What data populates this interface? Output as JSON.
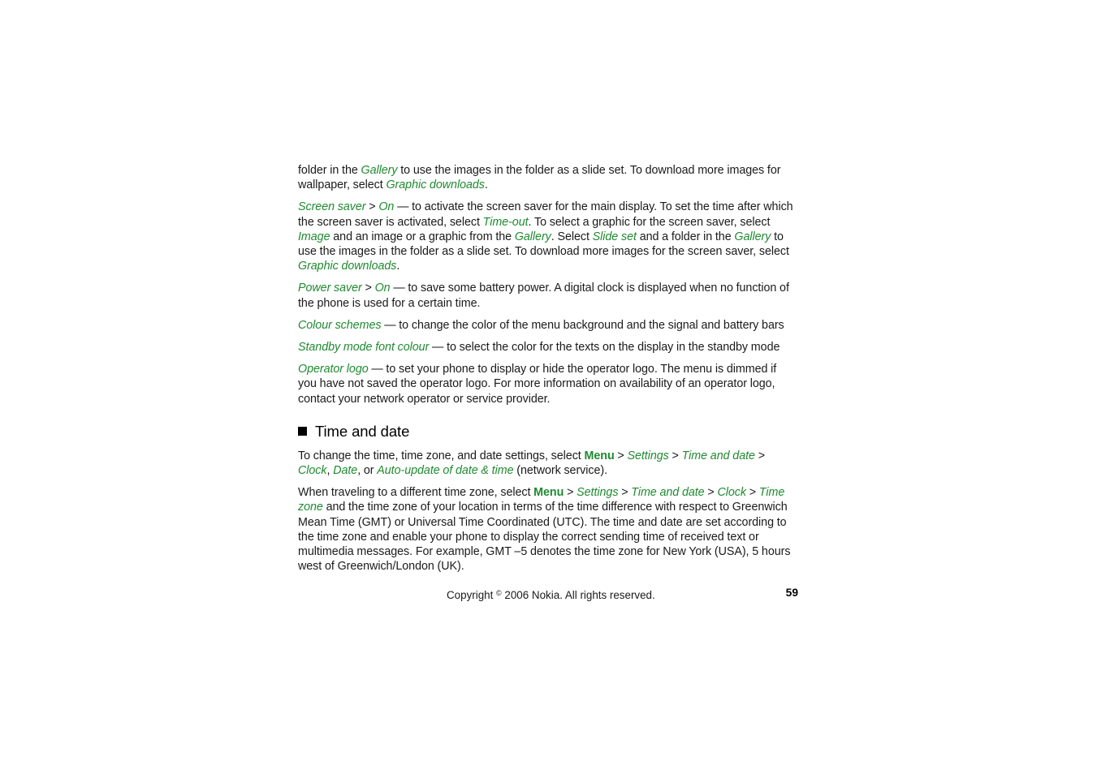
{
  "document": {
    "background_color": "#ffffff",
    "text_color": "#1a1a1a",
    "accent_color": "#1f8a30"
  },
  "body": {
    "paragraphs": [
      {
        "id": "wallpaper-folder",
        "runs": [
          {
            "style": "plain",
            "text": "folder in the "
          },
          {
            "style": "term",
            "text": "Gallery"
          },
          {
            "style": "plain",
            "text": " to use the images in the folder as a slide set. To download more images for wallpaper, select "
          },
          {
            "style": "term",
            "text": "Graphic downloads"
          },
          {
            "style": "plain",
            "text": "."
          }
        ]
      },
      {
        "id": "screen-saver",
        "runs": [
          {
            "style": "term",
            "text": "Screen saver"
          },
          {
            "style": "plain",
            "text": " > "
          },
          {
            "style": "term",
            "text": "On"
          },
          {
            "style": "plain",
            "text": " — to activate the screen saver for the main display. To set the time after which the screen saver is activated, select "
          },
          {
            "style": "term",
            "text": "Time-out"
          },
          {
            "style": "plain",
            "text": ". To select a graphic for the screen saver, select "
          },
          {
            "style": "term",
            "text": "Image"
          },
          {
            "style": "plain",
            "text": " and an image or a graphic from the "
          },
          {
            "style": "term",
            "text": "Gallery"
          },
          {
            "style": "plain",
            "text": ". Select "
          },
          {
            "style": "term",
            "text": "Slide set"
          },
          {
            "style": "plain",
            "text": " and a folder in the "
          },
          {
            "style": "term",
            "text": "Gallery"
          },
          {
            "style": "plain",
            "text": " to use the images in the folder as a slide set. To download more images for the screen saver, select "
          },
          {
            "style": "term",
            "text": "Graphic downloads"
          },
          {
            "style": "plain",
            "text": "."
          }
        ]
      },
      {
        "id": "power-saver",
        "runs": [
          {
            "style": "term",
            "text": "Power saver"
          },
          {
            "style": "plain",
            "text": " > "
          },
          {
            "style": "term",
            "text": "On"
          },
          {
            "style": "plain",
            "text": " — to save some battery power. A digital clock is displayed when no function of the phone is used for a certain time."
          }
        ]
      },
      {
        "id": "colour-schemes",
        "runs": [
          {
            "style": "term",
            "text": "Colour schemes"
          },
          {
            "style": "plain",
            "text": " — to change the color of the menu background and the signal and battery bars"
          }
        ]
      },
      {
        "id": "standby-mode-font-colour",
        "runs": [
          {
            "style": "term",
            "text": "Standby mode font colour"
          },
          {
            "style": "plain",
            "text": " — to select the color for the texts on the display in the standby mode"
          }
        ]
      },
      {
        "id": "operator-logo",
        "runs": [
          {
            "style": "term",
            "text": "Operator logo"
          },
          {
            "style": "plain",
            "text": " — to set your phone to display or hide the operator logo. The menu is dimmed if you have not saved the operator logo. For more information on availability of an operator logo, contact your network operator or service provider."
          }
        ]
      }
    ]
  },
  "section": {
    "heading": "Time and date",
    "bullet": "square-bullet",
    "paragraphs": [
      {
        "id": "change-time-settings",
        "runs": [
          {
            "style": "plain",
            "text": "To change the time, time zone, and date settings, select "
          },
          {
            "style": "term-bold",
            "text": "Menu"
          },
          {
            "style": "plain",
            "text": " > "
          },
          {
            "style": "term",
            "text": "Settings"
          },
          {
            "style": "plain",
            "text": " > "
          },
          {
            "style": "term",
            "text": "Time and date"
          },
          {
            "style": "plain",
            "text": " > "
          },
          {
            "style": "term",
            "text": "Clock"
          },
          {
            "style": "plain",
            "text": ", "
          },
          {
            "style": "term",
            "text": "Date"
          },
          {
            "style": "plain",
            "text": ", or "
          },
          {
            "style": "term",
            "text": "Auto-update of date & time"
          },
          {
            "style": "plain",
            "text": " (network service)."
          }
        ]
      },
      {
        "id": "traveling-time-zone",
        "runs": [
          {
            "style": "plain",
            "text": "When traveling to a different time zone, select "
          },
          {
            "style": "term-bold",
            "text": "Menu"
          },
          {
            "style": "plain",
            "text": " > "
          },
          {
            "style": "term",
            "text": "Settings"
          },
          {
            "style": "plain",
            "text": " > "
          },
          {
            "style": "term",
            "text": "Time and date"
          },
          {
            "style": "plain",
            "text": " > "
          },
          {
            "style": "term",
            "text": "Clock"
          },
          {
            "style": "plain",
            "text": " > "
          },
          {
            "style": "term",
            "text": "Time zone"
          },
          {
            "style": "plain",
            "text": " and the time zone of your location in terms of the time difference with respect to Greenwich Mean Time (GMT) or Universal Time Coordinated (UTC). The time and date are set according to the time zone and enable your phone to display the correct sending time of received text or multimedia messages. For example, GMT –5 denotes the time zone for New York (USA), 5 hours west of Greenwich/London (UK)."
          }
        ]
      }
    ]
  },
  "footer": {
    "copyright_prefix": "Copyright ",
    "copyright_symbol": "©",
    "copyright_suffix": " 2006 Nokia. All rights reserved.",
    "page_number": "59"
  }
}
